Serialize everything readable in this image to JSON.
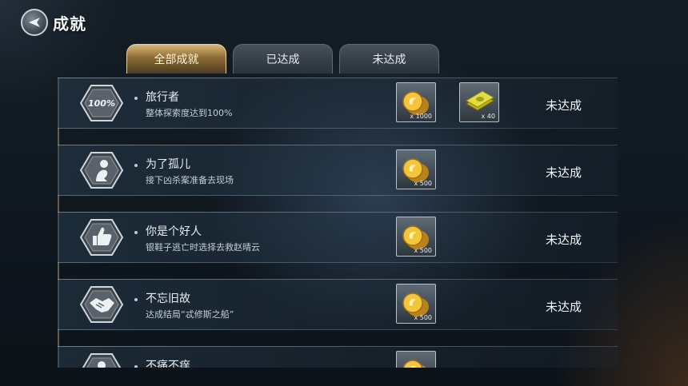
{
  "header": {
    "title": "成就"
  },
  "tabs": [
    {
      "label": "全部成就",
      "active": true
    },
    {
      "label": "已达成",
      "active": false
    },
    {
      "label": "未达成",
      "active": false
    }
  ],
  "achievements": [
    {
      "icon_text": "100%",
      "icon": "percent-badge-icon",
      "name": "旅行者",
      "desc": "整体探索度达到100%",
      "rewards": [
        {
          "icon": "gold-coin-icon",
          "qty": "x 1000"
        },
        {
          "icon": "cash-stack-icon",
          "qty": "x 40"
        }
      ],
      "status": "未达成"
    },
    {
      "icon": "figure-badge-icon",
      "name": "为了孤儿",
      "desc": "接下凶杀案准备去现场",
      "rewards": [
        {
          "icon": "gold-coin-icon",
          "qty": "x 500"
        }
      ],
      "status": "未达成"
    },
    {
      "icon": "thumbs-up-icon",
      "name": "你是个好人",
      "desc": "银鞋子逃亡时选择去救赵晴云",
      "rewards": [
        {
          "icon": "gold-coin-icon",
          "qty": "x 500"
        }
      ],
      "status": "未达成"
    },
    {
      "icon": "handshake-icon",
      "name": "不忘旧故",
      "desc": "达成结局“忒修斯之船”",
      "rewards": [
        {
          "icon": "gold-coin-icon",
          "qty": "x 500"
        }
      ],
      "status": "未达成"
    },
    {
      "icon": "figure-badge-icon",
      "name": "不痛不痒",
      "desc": "",
      "rewards": [
        {
          "icon": "gold-coin-icon",
          "qty": ""
        }
      ],
      "status": ""
    }
  ]
}
